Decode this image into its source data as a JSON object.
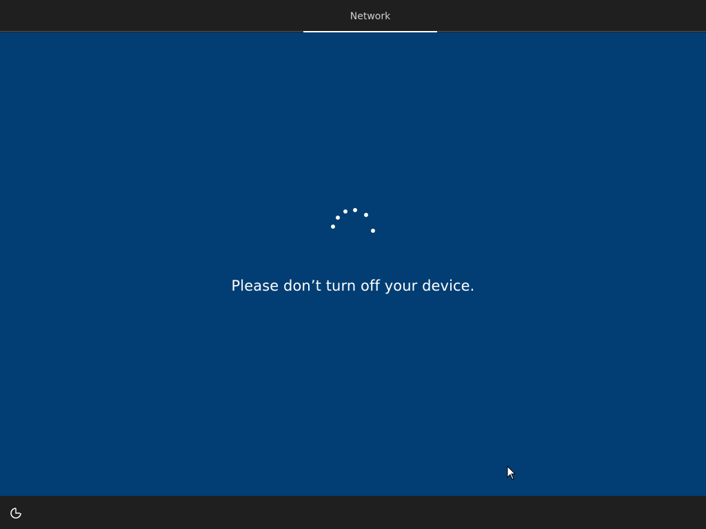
{
  "header": {
    "tab_label": "Network"
  },
  "main": {
    "message": "Please don’t turn off your device.",
    "spinner": "loading-dots-icon"
  },
  "footer": {
    "ease_of_access_icon": "ease-of-access-icon"
  },
  "colors": {
    "background": "#023e73",
    "bars": "#1f1f1f",
    "text": "#ffffff"
  }
}
